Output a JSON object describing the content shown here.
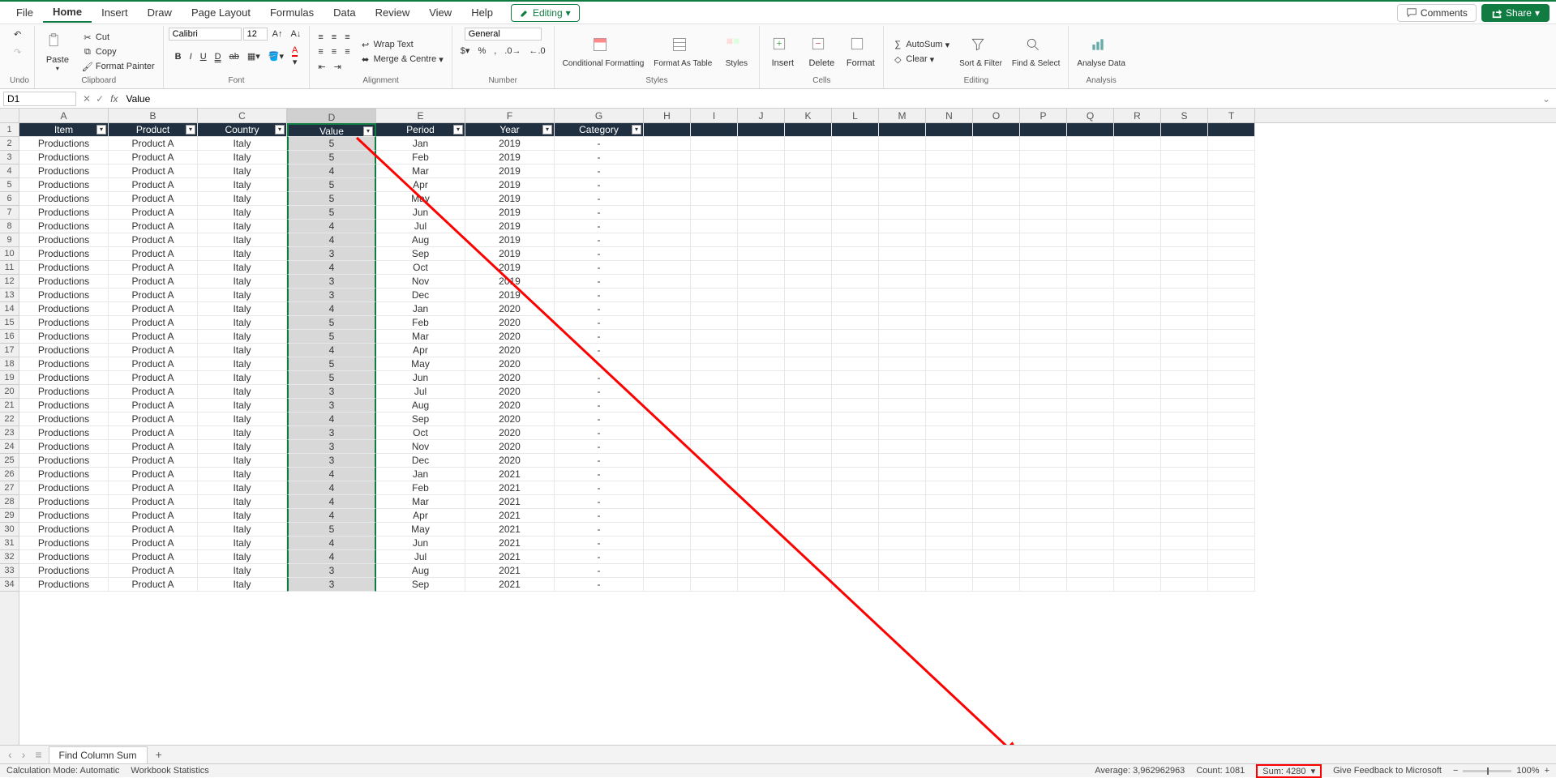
{
  "menu": {
    "tabs": [
      "File",
      "Home",
      "Insert",
      "Draw",
      "Page Layout",
      "Formulas",
      "Data",
      "Review",
      "View",
      "Help"
    ],
    "active": "Home",
    "editing": "Editing",
    "comments": "Comments",
    "share": "Share"
  },
  "ribbon": {
    "undo_label": "Undo",
    "clipboard": {
      "paste": "Paste",
      "cut": "Cut",
      "copy": "Copy",
      "painter": "Format Painter",
      "label": "Clipboard"
    },
    "font": {
      "name": "Calibri",
      "size": "12",
      "label": "Font"
    },
    "alignment": {
      "wrap": "Wrap Text",
      "merge": "Merge & Centre",
      "label": "Alignment"
    },
    "number": {
      "format": "General",
      "label": "Number"
    },
    "styles": {
      "cond": "Conditional Formatting",
      "fat": "Format As Table",
      "styles": "Styles",
      "label": "Styles"
    },
    "cells": {
      "insert": "Insert",
      "delete": "Delete",
      "format": "Format",
      "label": "Cells"
    },
    "editing": {
      "autosum": "AutoSum",
      "clear": "Clear",
      "sort": "Sort & Filter",
      "find": "Find & Select",
      "label": "Editing"
    },
    "analysis": {
      "analyse": "Analyse Data",
      "label": "Analysis"
    }
  },
  "formulabar": {
    "namebox": "D1",
    "value": "Value"
  },
  "columns": [
    "A",
    "B",
    "C",
    "D",
    "E",
    "F",
    "G",
    "H",
    "I",
    "J",
    "K",
    "L",
    "M",
    "N",
    "O",
    "P",
    "Q",
    "R",
    "S",
    "T"
  ],
  "dataColCount": 7,
  "selectedCol": 3,
  "headers": [
    "Item",
    "Product",
    "Country",
    "Value",
    "Period",
    "Year",
    "Category"
  ],
  "rows": [
    [
      "Productions",
      "Product A",
      "Italy",
      "5",
      "Jan",
      "2019",
      "-"
    ],
    [
      "Productions",
      "Product A",
      "Italy",
      "5",
      "Feb",
      "2019",
      "-"
    ],
    [
      "Productions",
      "Product A",
      "Italy",
      "4",
      "Mar",
      "2019",
      "-"
    ],
    [
      "Productions",
      "Product A",
      "Italy",
      "5",
      "Apr",
      "2019",
      "-"
    ],
    [
      "Productions",
      "Product A",
      "Italy",
      "5",
      "May",
      "2019",
      "-"
    ],
    [
      "Productions",
      "Product A",
      "Italy",
      "5",
      "Jun",
      "2019",
      "-"
    ],
    [
      "Productions",
      "Product A",
      "Italy",
      "4",
      "Jul",
      "2019",
      "-"
    ],
    [
      "Productions",
      "Product A",
      "Italy",
      "4",
      "Aug",
      "2019",
      "-"
    ],
    [
      "Productions",
      "Product A",
      "Italy",
      "3",
      "Sep",
      "2019",
      "-"
    ],
    [
      "Productions",
      "Product A",
      "Italy",
      "4",
      "Oct",
      "2019",
      "-"
    ],
    [
      "Productions",
      "Product A",
      "Italy",
      "3",
      "Nov",
      "2019",
      "-"
    ],
    [
      "Productions",
      "Product A",
      "Italy",
      "3",
      "Dec",
      "2019",
      "-"
    ],
    [
      "Productions",
      "Product A",
      "Italy",
      "4",
      "Jan",
      "2020",
      "-"
    ],
    [
      "Productions",
      "Product A",
      "Italy",
      "5",
      "Feb",
      "2020",
      "-"
    ],
    [
      "Productions",
      "Product A",
      "Italy",
      "5",
      "Mar",
      "2020",
      "-"
    ],
    [
      "Productions",
      "Product A",
      "Italy",
      "4",
      "Apr",
      "2020",
      "-"
    ],
    [
      "Productions",
      "Product A",
      "Italy",
      "5",
      "May",
      "2020",
      "-"
    ],
    [
      "Productions",
      "Product A",
      "Italy",
      "5",
      "Jun",
      "2020",
      "-"
    ],
    [
      "Productions",
      "Product A",
      "Italy",
      "3",
      "Jul",
      "2020",
      "-"
    ],
    [
      "Productions",
      "Product A",
      "Italy",
      "3",
      "Aug",
      "2020",
      "-"
    ],
    [
      "Productions",
      "Product A",
      "Italy",
      "4",
      "Sep",
      "2020",
      "-"
    ],
    [
      "Productions",
      "Product A",
      "Italy",
      "3",
      "Oct",
      "2020",
      "-"
    ],
    [
      "Productions",
      "Product A",
      "Italy",
      "3",
      "Nov",
      "2020",
      "-"
    ],
    [
      "Productions",
      "Product A",
      "Italy",
      "3",
      "Dec",
      "2020",
      "-"
    ],
    [
      "Productions",
      "Product A",
      "Italy",
      "4",
      "Jan",
      "2021",
      "-"
    ],
    [
      "Productions",
      "Product A",
      "Italy",
      "4",
      "Feb",
      "2021",
      "-"
    ],
    [
      "Productions",
      "Product A",
      "Italy",
      "4",
      "Mar",
      "2021",
      "-"
    ],
    [
      "Productions",
      "Product A",
      "Italy",
      "4",
      "Apr",
      "2021",
      "-"
    ],
    [
      "Productions",
      "Product A",
      "Italy",
      "5",
      "May",
      "2021",
      "-"
    ],
    [
      "Productions",
      "Product A",
      "Italy",
      "4",
      "Jun",
      "2021",
      "-"
    ],
    [
      "Productions",
      "Product A",
      "Italy",
      "4",
      "Jul",
      "2021",
      "-"
    ],
    [
      "Productions",
      "Product A",
      "Italy",
      "3",
      "Aug",
      "2021",
      "-"
    ],
    [
      "Productions",
      "Product A",
      "Italy",
      "3",
      "Sep",
      "2021",
      "-"
    ]
  ],
  "sheet": {
    "name": "Find Column Sum"
  },
  "status": {
    "calc": "Calculation Mode: Automatic",
    "wbstats": "Workbook Statistics",
    "average": "Average: 3,962962963",
    "count": "Count: 1081",
    "sum": "Sum: 4280",
    "feedback": "Give Feedback to Microsoft",
    "zoom": "100%"
  }
}
